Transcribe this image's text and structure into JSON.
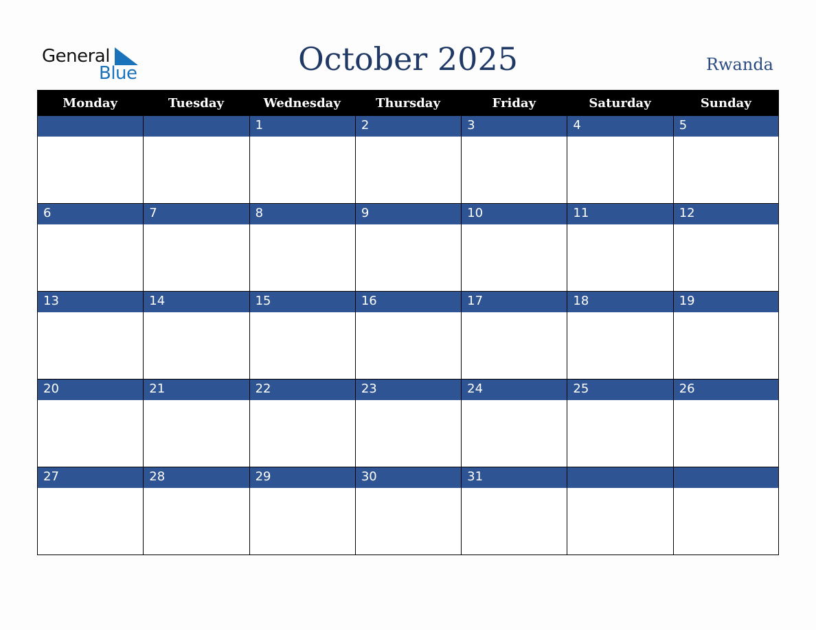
{
  "logo": {
    "word1": "General",
    "word2": "Blue"
  },
  "title": "October 2025",
  "country": "Rwanda",
  "colors": {
    "header_bg": "#000000",
    "date_bar": "#2e5493",
    "title": "#1f3864",
    "logo_blue": "#1a72bb"
  },
  "weekdays": [
    "Monday",
    "Tuesday",
    "Wednesday",
    "Thursday",
    "Friday",
    "Saturday",
    "Sunday"
  ],
  "weeks": [
    [
      "",
      "",
      "1",
      "2",
      "3",
      "4",
      "5"
    ],
    [
      "6",
      "7",
      "8",
      "9",
      "10",
      "11",
      "12"
    ],
    [
      "13",
      "14",
      "15",
      "16",
      "17",
      "18",
      "19"
    ],
    [
      "20",
      "21",
      "22",
      "23",
      "24",
      "25",
      "26"
    ],
    [
      "27",
      "28",
      "29",
      "30",
      "31",
      "",
      ""
    ]
  ]
}
